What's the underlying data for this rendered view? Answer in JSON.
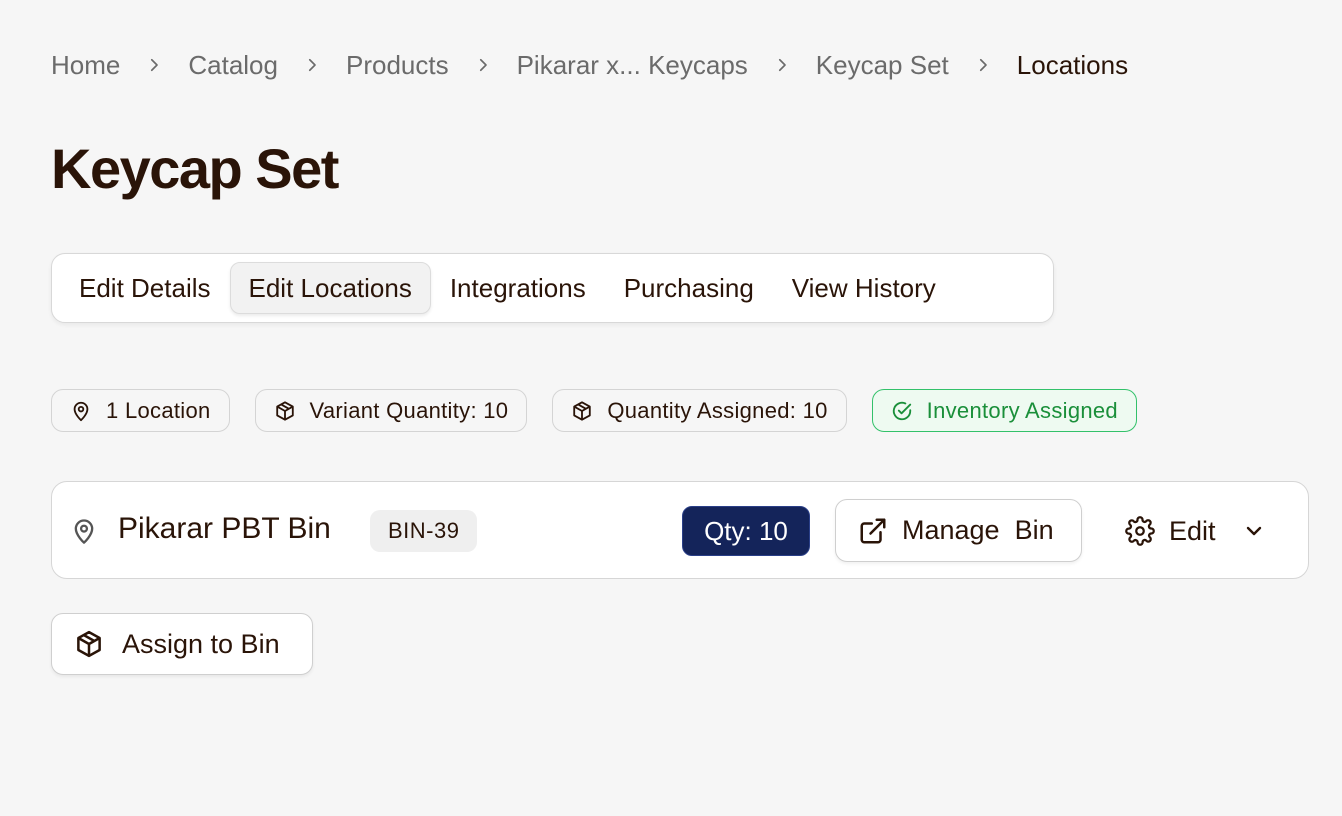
{
  "breadcrumb": {
    "items": [
      "Home",
      "Catalog",
      "Products",
      "Pikarar x... Keycaps",
      "Keycap Set",
      "Locations"
    ]
  },
  "page": {
    "title": "Keycap Set"
  },
  "tabs": [
    {
      "label": "Edit Details",
      "active": false
    },
    {
      "label": "Edit Locations",
      "active": true
    },
    {
      "label": "Integrations",
      "active": false
    },
    {
      "label": "Purchasing",
      "active": false
    },
    {
      "label": "View History",
      "active": false
    }
  ],
  "badges": {
    "locations": {
      "label": "1 Location",
      "icon": "map-pin-icon"
    },
    "variant_quantity": {
      "label": "Variant Quantity: 10",
      "icon": "box-icon"
    },
    "quantity_assigned": {
      "label": "Quantity Assigned: 10",
      "icon": "box-icon"
    },
    "status": {
      "label": "Inventory Assigned",
      "icon": "check-circle-icon",
      "color": "#1a8f3a"
    }
  },
  "bin": {
    "name": "Pikarar PBT Bin",
    "code": "BIN-39",
    "qty_label": "Qty: 10",
    "manage_label": "Manage  Bin",
    "edit_label": "Edit"
  },
  "actions": {
    "assign_label": "Assign to Bin"
  },
  "colors": {
    "accent_navy": "#14245a",
    "success_green": "#1a8f3a",
    "text_primary": "#2a1408"
  }
}
